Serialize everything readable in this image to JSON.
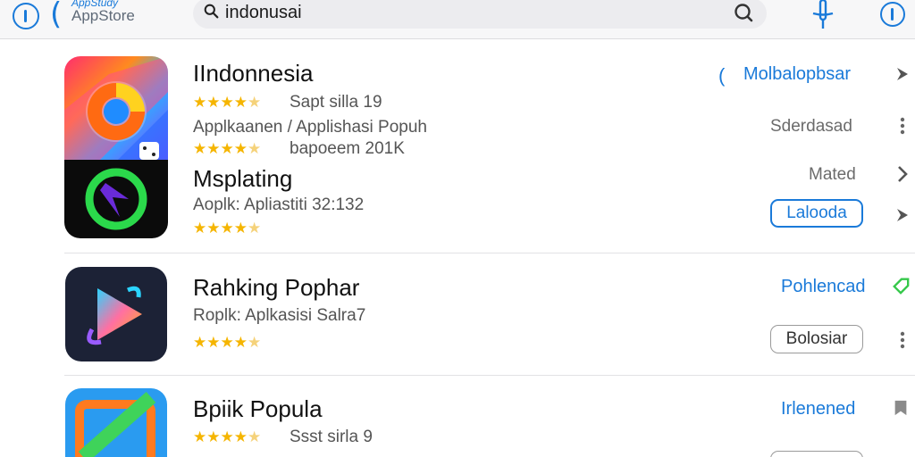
{
  "header": {
    "store_subtitle": "AppStudy",
    "store_name": "AppStore",
    "search_value": "indonusai"
  },
  "apps": [
    {
      "title": "IIndonnesia",
      "rating_stars": 4.5,
      "rating_text": "Sapt silla 19",
      "category": "Applkaanen / Applishasi Popuh",
      "secondary_rating_text": "bapoeem 201K",
      "action_link": "Molbalopbsar",
      "status_text": "Sderdasad"
    },
    {
      "title": "Msplating",
      "category": "Aoplk: Apliastiti 32:132",
      "rating_stars": 4.5,
      "status_text": "Mated",
      "button_label": "Lalooda"
    },
    {
      "title": "Rahking Pophar",
      "category": "Roplk: Aplkasisi Salra7",
      "rating_stars": 4.5,
      "action_link": "Pohlencad",
      "button_label": "Bolosiar"
    },
    {
      "title": "Bpiik Popula",
      "rating_stars": 4.5,
      "rating_text": "Ssst sirla 9",
      "action_link": "Irlenened"
    }
  ],
  "colors": {
    "accent": "#1a7ad9",
    "star": "#f5b500",
    "green_accent": "#35c84a"
  }
}
